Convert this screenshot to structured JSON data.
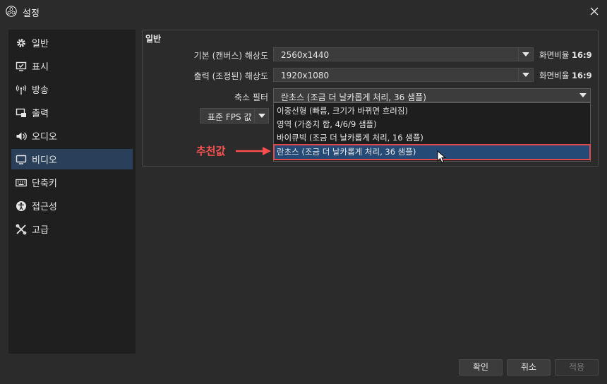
{
  "window": {
    "title": "설정"
  },
  "sidebar": {
    "items": [
      {
        "label": "일반",
        "icon": "gear-icon"
      },
      {
        "label": "표시",
        "icon": "monitor-check-icon"
      },
      {
        "label": "방송",
        "icon": "antenna-icon"
      },
      {
        "label": "출력",
        "icon": "output-icon"
      },
      {
        "label": "오디오",
        "icon": "speaker-icon"
      },
      {
        "label": "비디오",
        "icon": "monitor-icon",
        "active": true
      },
      {
        "label": "단축키",
        "icon": "keyboard-icon"
      },
      {
        "label": "접근성",
        "icon": "accessibility-icon"
      },
      {
        "label": "고급",
        "icon": "tools-icon"
      }
    ]
  },
  "general": {
    "title": "일반",
    "base_resolution": {
      "label": "기본 (캔버스) 해상도",
      "value": "2560x1440",
      "ratio_prefix": "화면비율",
      "ratio_value": "16:9"
    },
    "output_resolution": {
      "label": "출력 (조정된) 해상도",
      "value": "1920x1080",
      "ratio_prefix": "화면비율",
      "ratio_value": "16:9"
    },
    "downscale_filter": {
      "label": "축소 필터",
      "value": "란초스 (조금 더 날카롭게 처리, 36 샘플)",
      "options": [
        "이중선형 (빠름, 크기가 바뀌면 흐려짐)",
        "영역 (가중치 합, 4/6/9 샘플)",
        "바이큐빅 (조금 더 날카롭게 처리, 16 샘플)",
        "란초스 (조금 더 날카롭게 처리, 36 샘플)"
      ],
      "selected_index": 3
    },
    "fps": {
      "label": "표준 FPS 값"
    }
  },
  "annotation": {
    "text": "추천값",
    "color": "#ff4d4d"
  },
  "buttons": {
    "ok": "확인",
    "cancel": "취소",
    "apply": "적용"
  },
  "colors": {
    "active_nav": "#2a3f5a",
    "selected_option": "#254a75",
    "highlight_border": "#e14a4a"
  }
}
